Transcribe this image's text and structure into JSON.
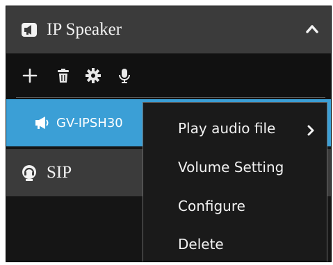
{
  "ip_speaker": {
    "title": "IP Speaker",
    "expanded_icon": "chevron-up-icon"
  },
  "toolbar": {
    "icons": [
      "plus-icon",
      "trash-icon",
      "gear-icon",
      "microphone-icon"
    ]
  },
  "device": {
    "name": "GV-IPSH30",
    "icon": "speaker-icon"
  },
  "sip": {
    "title": "SIP",
    "icon": "headset-icon"
  },
  "context_menu": {
    "items": [
      {
        "label": "Play audio file",
        "has_submenu": true
      },
      {
        "label": "Volume Setting",
        "has_submenu": false
      },
      {
        "label": "Configure",
        "has_submenu": false
      },
      {
        "label": "Delete",
        "has_submenu": false
      }
    ]
  },
  "colors": {
    "panel_bg": "#151515",
    "header_bg": "#3b3b3b",
    "selected_bg": "#3b9fd6",
    "menu_bg": "#1a1a1a",
    "text": "#f2f2f2"
  }
}
